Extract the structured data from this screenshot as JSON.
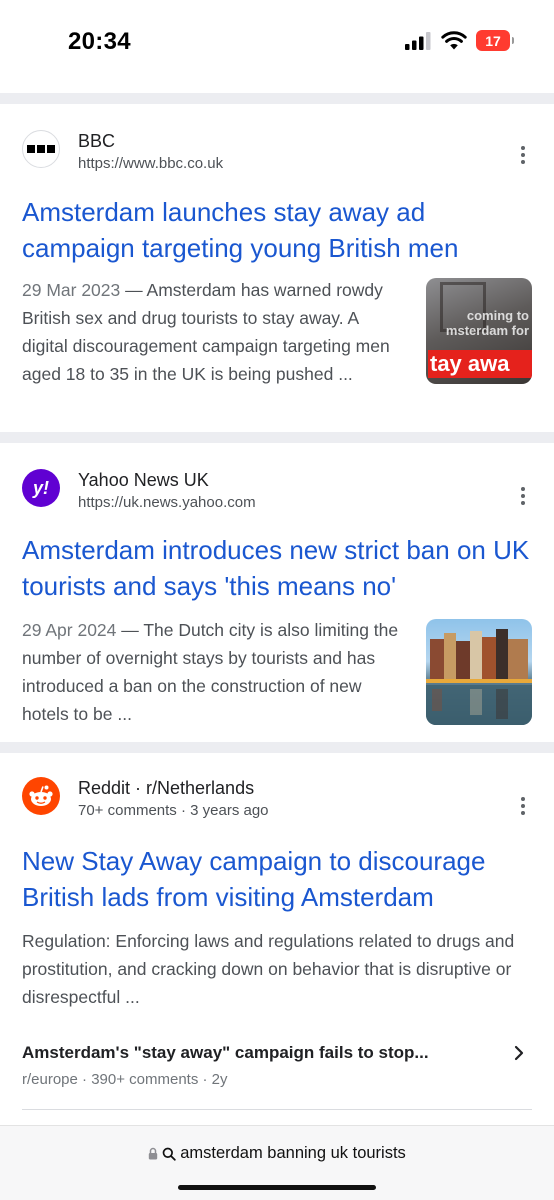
{
  "status_bar": {
    "time": "20:34",
    "battery": "17",
    "battery_color": "#ff3b30"
  },
  "results": [
    {
      "source": "BBC",
      "url": "https://www.bbc.co.uk",
      "logo_icon": "bbc-logo-icon",
      "title": "Amsterdam launches stay away ad campaign targeting young British men",
      "date": "29 Mar 2023",
      "snippet": "Amsterdam has warned rowdy British sex and drug tourists to stay away. A digital discouragement campaign targeting men aged 18 to 35 in the UK is being pushed ...",
      "thumb_lines": [
        "coming to",
        "msterdam for",
        "tay awa"
      ]
    },
    {
      "source": "Yahoo News UK",
      "url": "https://uk.news.yahoo.com",
      "logo_icon": "yahoo-logo-icon",
      "logo_text": "y!",
      "title": "Amsterdam introduces new strict ban on UK tourists and says 'this means no'",
      "date": "29 Apr 2024",
      "snippet": "The Dutch city is also limiting the number of overnight stays by tourists and has introduced a ban on the construction of new hotels to be ..."
    },
    {
      "source": "Reddit · r/Netherlands",
      "meta": "70+ comments · 3 years ago",
      "logo_icon": "reddit-logo-icon",
      "title": "New Stay Away campaign to discourage British lads from visiting Amsterdam",
      "snippet": "Regulation: Enforcing laws and regulations related to drugs and prostitution, and cracking down on behavior that is disruptive or disrespectful ...",
      "sub_result": {
        "title": "Amsterdam's \"stay away\" campaign fails to stop...",
        "meta": "r/europe · 390+ comments · 2y"
      }
    }
  ],
  "url_bar": {
    "text": "amsterdam banning uk tourists"
  },
  "colors": {
    "link": "#1a57d0",
    "divider": "#ecedf1",
    "reddit": "#ff4500",
    "yahoo": "#6001d2"
  }
}
